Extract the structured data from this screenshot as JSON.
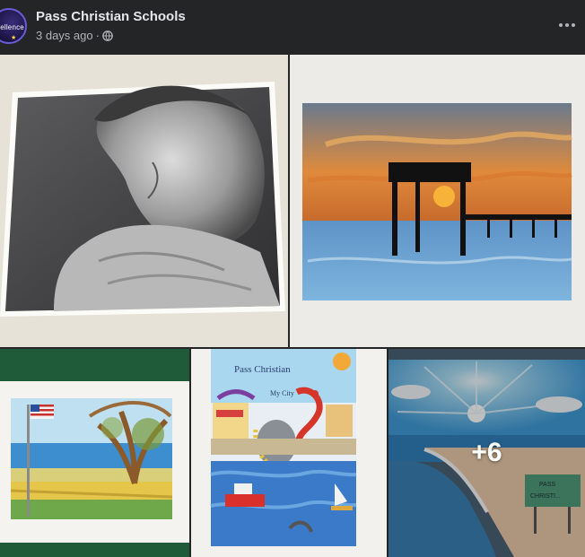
{
  "post": {
    "page_name": "Pass Christian Schools",
    "time": "3 days ago",
    "separator": "·",
    "privacy_icon": "globe-icon",
    "more_icon": "more-dots-icon",
    "avatar_text": "cellence"
  },
  "gallery": {
    "photos": [
      {
        "description": "charcoal portrait",
        "icon": "photo"
      },
      {
        "description": "sunset pier",
        "icon": "photo"
      },
      {
        "description": "flag landscape",
        "icon": "photo"
      },
      {
        "description": "city collage",
        "icon": "photo"
      },
      {
        "description": "beach",
        "icon": "photo"
      }
    ],
    "more_count": "+6"
  },
  "artwork": {
    "city_title": "Pass Christian",
    "city_subtitle": "My City",
    "sign_line1": "PASS",
    "sign_line2": "CHRISTI..."
  },
  "colors": {
    "background": "#242526",
    "text_primary": "#e4e6eb",
    "text_secondary": "#b0b3b8"
  }
}
